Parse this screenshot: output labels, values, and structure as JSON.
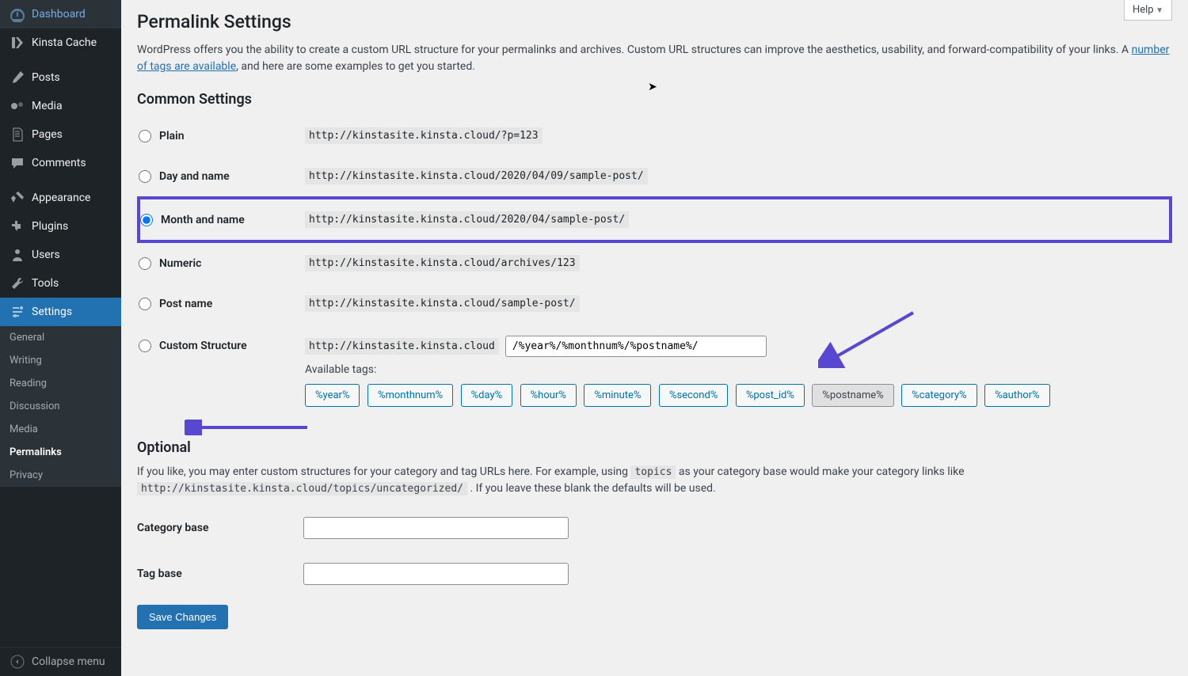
{
  "sidebar": {
    "items": [
      {
        "icon": "dashboard-icon",
        "label": "Dashboard"
      },
      {
        "icon": "kinsta-icon",
        "label": "Kinsta Cache"
      },
      {
        "icon": "posts-icon",
        "label": "Posts"
      },
      {
        "icon": "media-icon",
        "label": "Media"
      },
      {
        "icon": "pages-icon",
        "label": "Pages"
      },
      {
        "icon": "comments-icon",
        "label": "Comments"
      },
      {
        "icon": "appearance-icon",
        "label": "Appearance"
      },
      {
        "icon": "plugins-icon",
        "label": "Plugins"
      },
      {
        "icon": "users-icon",
        "label": "Users"
      },
      {
        "icon": "tools-icon",
        "label": "Tools"
      },
      {
        "icon": "settings-icon",
        "label": "Settings"
      }
    ],
    "submenu": [
      "General",
      "Writing",
      "Reading",
      "Discussion",
      "Media",
      "Permalinks",
      "Privacy"
    ],
    "collapse": "Collapse menu"
  },
  "header": {
    "help": "Help"
  },
  "page": {
    "title": "Permalink Settings",
    "intro1": "WordPress offers you the ability to create a custom URL structure for your permalinks and archives. Custom URL structures can improve the aesthetics, usability, and forward-compatibility of your links. A ",
    "intro_link": "number of tags are available",
    "intro2": ", and here are some examples to get you started.",
    "common_heading": "Common Settings",
    "options": [
      {
        "label": "Plain",
        "example": "http://kinstasite.kinsta.cloud/?p=123",
        "checked": false
      },
      {
        "label": "Day and name",
        "example": "http://kinstasite.kinsta.cloud/2020/04/09/sample-post/",
        "checked": false
      },
      {
        "label": "Month and name",
        "example": "http://kinstasite.kinsta.cloud/2020/04/sample-post/",
        "checked": true
      },
      {
        "label": "Numeric",
        "example": "http://kinstasite.kinsta.cloud/archives/123",
        "checked": false
      },
      {
        "label": "Post name",
        "example": "http://kinstasite.kinsta.cloud/sample-post/",
        "checked": false
      }
    ],
    "custom_label": "Custom Structure",
    "custom_base": "http://kinstasite.kinsta.cloud",
    "custom_value": "/%year%/%monthnum%/%postname%/",
    "available_tags_label": "Available tags:",
    "tags": [
      "%year%",
      "%monthnum%",
      "%day%",
      "%hour%",
      "%minute%",
      "%second%",
      "%post_id%",
      "%postname%",
      "%category%",
      "%author%"
    ],
    "tags_active": [
      "%postname%"
    ],
    "optional_heading": "Optional",
    "optional1": "If you like, you may enter custom structures for your category and tag URLs here. For example, using ",
    "optional_code1": "topics",
    "optional2": " as your category base would make your category links like ",
    "optional_code2": "http://kinstasite.kinsta.cloud/topics/uncategorized/",
    "optional3": " . If you leave these blank the defaults will be used.",
    "category_base_label": "Category base",
    "tag_base_label": "Tag base",
    "save_label": "Save Changes"
  }
}
